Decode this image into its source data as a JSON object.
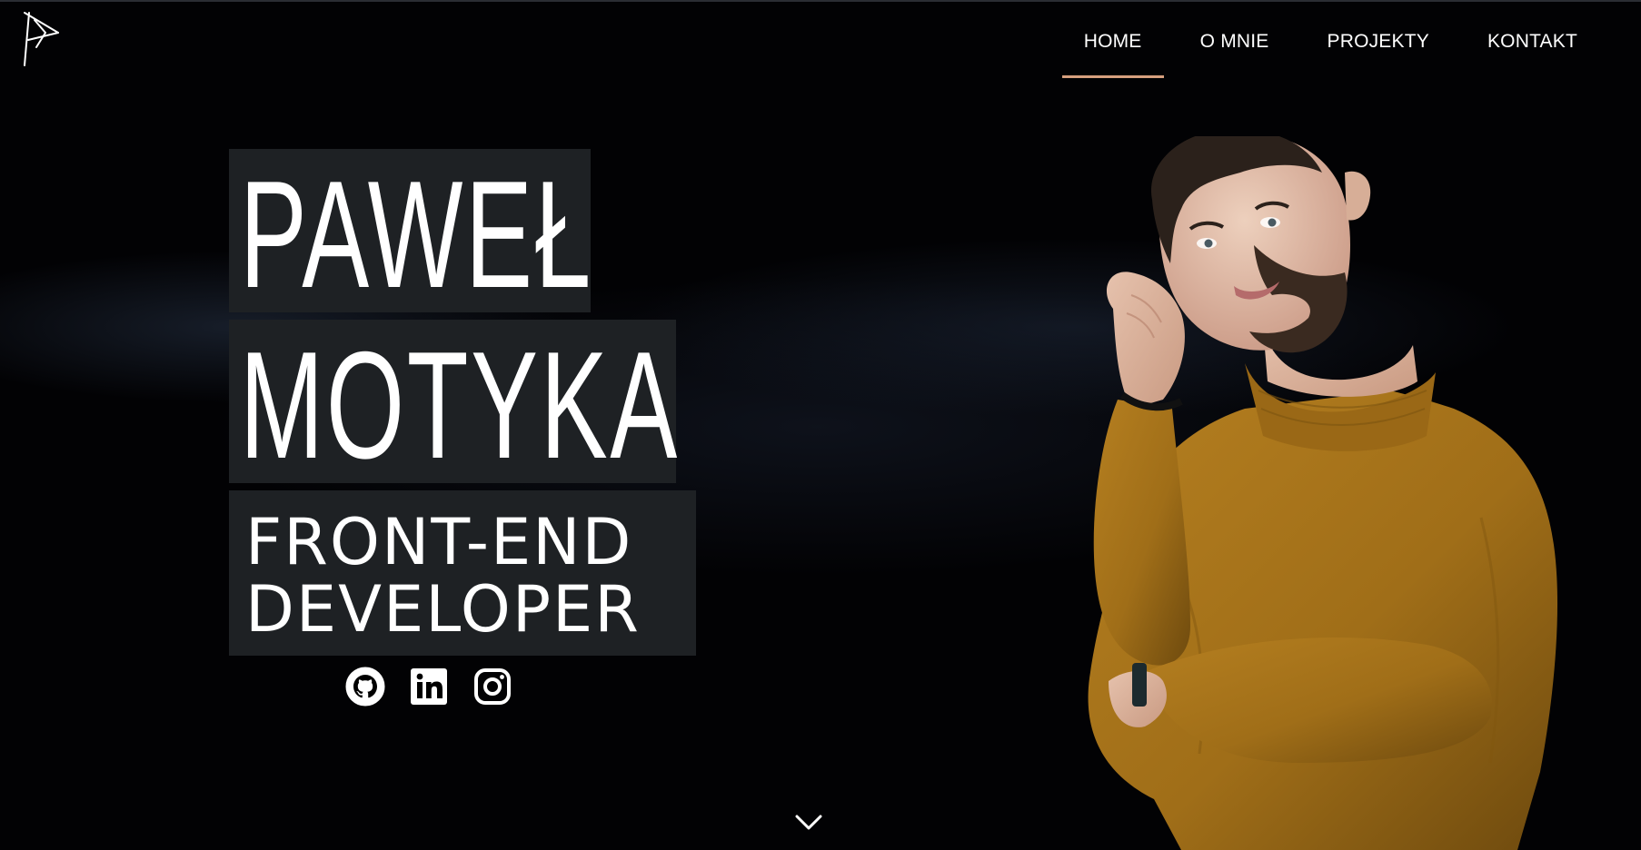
{
  "logo": {
    "icon": "logo-icon"
  },
  "nav": {
    "items": [
      {
        "label": "HOME",
        "active": true
      },
      {
        "label": "O MNIE",
        "active": false
      },
      {
        "label": "PROJEKTY",
        "active": false
      },
      {
        "label": "KONTAKT",
        "active": false
      }
    ],
    "accent": "#d6a07e"
  },
  "hero": {
    "first_name": "PAWEŁ",
    "last_name": "MOTYKA",
    "role_line1": "FRONT-END",
    "role_line2": "DEVELOPER",
    "block_bg": "#1e2124"
  },
  "social": [
    {
      "icon": "github-icon"
    },
    {
      "icon": "linkedin-icon"
    },
    {
      "icon": "instagram-icon"
    }
  ],
  "scroll": {
    "icon": "chevron-down-icon"
  },
  "colors": {
    "background": "#020204",
    "sweater": "#a8741a",
    "text": "#ffffff"
  }
}
